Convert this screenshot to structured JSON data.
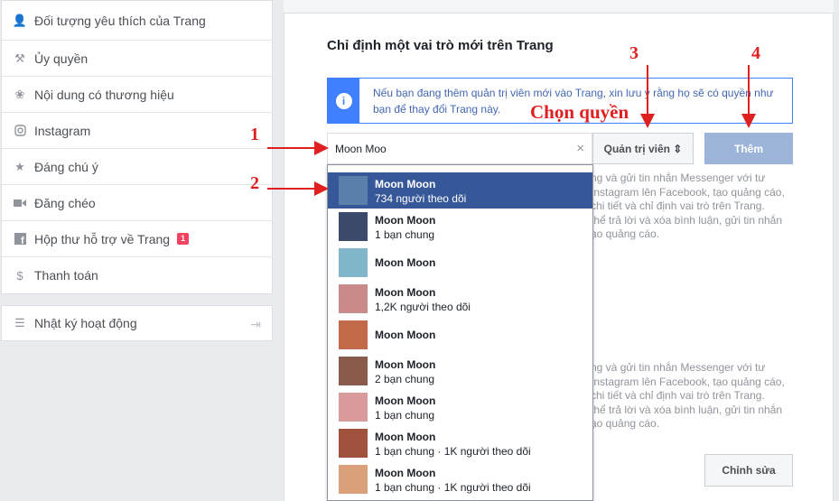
{
  "sidebar": {
    "items": [
      {
        "label": "Đối tượng yêu thích của Trang",
        "icon": "audience-icon"
      },
      {
        "label": "Ủy quyền",
        "icon": "wrench-icon"
      },
      {
        "label": "Nội dung có thương hiệu",
        "icon": "handshake-icon"
      },
      {
        "label": "Instagram",
        "icon": "instagram-icon"
      },
      {
        "label": "Đáng chú ý",
        "icon": "star-icon"
      },
      {
        "label": "Đăng chéo",
        "icon": "video-icon"
      },
      {
        "label": "Hộp thư hỗ trợ về Trang",
        "icon": "facebook-icon",
        "badge": "1"
      },
      {
        "label": "Thanh toán",
        "icon": "dollar-icon"
      }
    ],
    "activity_log": {
      "label": "Nhật ký hoạt động",
      "icon": "list-icon"
    }
  },
  "main": {
    "title": "Chỉ định một vai trò mới trên Trang",
    "info_text": "Nếu bạn đang thêm quản trị viên mới vào Trang, xin lưu ý rằng họ sẽ có quyền như bạn để thay đổi Trang này.",
    "search_value": "Moon Moo",
    "role_label": "Quản trị viên ⇕",
    "add_label": "Thêm",
    "edit_label": "Chỉnh sửa",
    "bg_text_1": [
      "ng và gửi tin nhắn Messenger với tư",
      "Instagram lên Facebook, tạo quảng cáo,",
      "chi tiết và chỉ định vai trò trên Trang.",
      "thể trả lời và xóa bình luận, gửi tin nhắn",
      "ạo quảng cáo."
    ],
    "bg_text_2": [
      "ng và gửi tin nhắn Messenger với tư",
      "Instagram lên Facebook, tạo quảng cáo,",
      "chi tiết và chỉ định vai trò trên Trang.",
      "thể trả lời và xóa bình luận, gửi tin nhắn",
      "ạo quảng cáo."
    ]
  },
  "dropdown": [
    {
      "name": "Moon Moon",
      "sub": "734 người theo dõi",
      "selected": true,
      "thumb": "#5a7fa8"
    },
    {
      "name": "Moon Moon",
      "sub": "1 bạn chung",
      "thumb": "#3b4a6b"
    },
    {
      "name": "Moon Moon",
      "sub": "",
      "thumb": "#7fb6c9"
    },
    {
      "name": "Moon Moon",
      "sub": "1,2K người theo dõi",
      "thumb": "#c98a8a"
    },
    {
      "name": "Moon Moon",
      "sub": "",
      "thumb": "#c26a4a"
    },
    {
      "name": "Moon Moon",
      "sub": "2 bạn chung",
      "thumb": "#8a5a4a"
    },
    {
      "name": "Moon Moon",
      "sub": "1 bạn chung",
      "thumb": "#d89a9a"
    },
    {
      "name": "Moon Moon",
      "sub": "1 bạn chung · 1K người theo dõi",
      "thumb": "#a0523d"
    },
    {
      "name": "Moon Moon",
      "sub": "1 bạn chung · 1K người theo dõi",
      "thumb": "#d9a07a"
    }
  ],
  "annotations": {
    "n1": "1",
    "n2": "2",
    "n3": "3",
    "n4": "4",
    "choose": "Chọn quyền"
  }
}
